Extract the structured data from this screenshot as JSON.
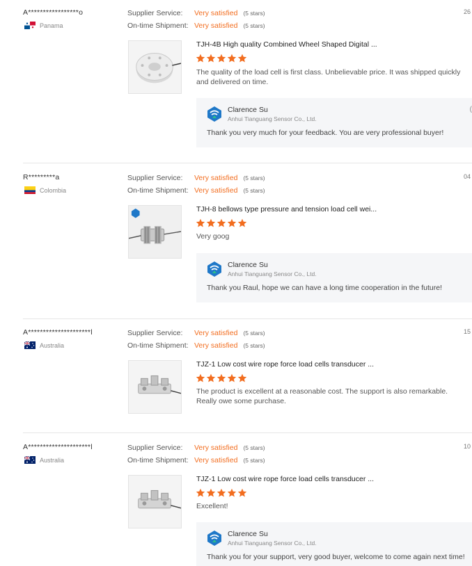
{
  "labels": {
    "supplier_service": "Supplier Service:",
    "ontime_shipment": "On-time Shipment:",
    "rating_value": "Very satisfied",
    "rating_stars": "(5 stars)"
  },
  "colors": {
    "accent_orange": "#f26d1f",
    "reply_bg": "#f5f6f8",
    "divider": "#e6e6e6"
  },
  "reviews": [
    {
      "buyer": "A*****************o",
      "country": "Panama",
      "flag_icon": "panama-flag-icon",
      "date": "26",
      "product_title": "TJH-4B High quality Combined Wheel Shaped Digital ...",
      "rating": 5,
      "text": "The quality of the load cell is first class. Unbelievable price. It was shipped quickly and delivered on time.",
      "reply": {
        "name": "Clarence Su",
        "company": "Anhui Tianguang Sensor Co., Ltd.",
        "text": "Thank you very much for your feedback. You are very professional buyer!",
        "edge": "("
      }
    },
    {
      "buyer": "R*********a",
      "country": "Colombia",
      "flag_icon": "colombia-flag-icon",
      "date": "04",
      "product_title": "TJH-8 bellows type pressure and tension load cell wei...",
      "rating": 5,
      "text": "Very goog",
      "reply": {
        "name": "Clarence Su",
        "company": "Anhui Tianguang Sensor Co., Ltd.",
        "text": "Thank you Raul, hope we can have a long time cooperation in the future!",
        "edge": ""
      }
    },
    {
      "buyer": "A*********************l",
      "country": "Australia",
      "flag_icon": "australia-flag-icon",
      "date": "15",
      "product_title": "TJZ-1 Low cost wire rope force load cells transducer ...",
      "rating": 5,
      "text": "The product is excellent at a reasonable cost. The support is also remarkable. Really owe some purchase.",
      "reply": null
    },
    {
      "buyer": "A*********************l",
      "country": "Australia",
      "flag_icon": "australia-flag-icon",
      "date": "10",
      "product_title": "TJZ-1 Low cost wire rope force load cells transducer ...",
      "rating": 5,
      "text": "Excellent!",
      "reply": {
        "name": "Clarence Su",
        "company": "Anhui Tianguang Sensor Co., Ltd.",
        "text": "Thank you for your support, very good buyer, welcome to come again next time!",
        "edge": ""
      }
    }
  ]
}
